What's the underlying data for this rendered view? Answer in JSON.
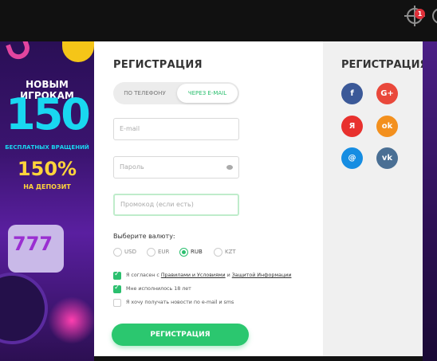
{
  "header": {
    "notification_count": "1"
  },
  "banner": {
    "line1": "НОВЫМ ИГРОКАМ",
    "line2": "150",
    "line3": "БЕСПЛАТНЫХ ВРАЩЕНИЙ",
    "line4": "150%",
    "line5": "НА ДЕПОЗИТ"
  },
  "form": {
    "title": "РЕГИСТРАЦИЯ",
    "tab_phone": "ПО ТЕЛЕФОНУ",
    "tab_email": "ЧЕРЕЗ E-MAIL",
    "email_placeholder": "E-mail",
    "password_placeholder": "Пароль",
    "promo_placeholder": "Промокод (если есть)",
    "currency_label": "Выберите валюту:",
    "currencies": [
      "USD",
      "EUR",
      "RUB",
      "KZT"
    ],
    "selected_currency": "RUB",
    "agree_prefix": "Я согласен с ",
    "agree_rules": "Правилами и Условиями",
    "agree_and": " и ",
    "agree_privacy": "Защитой Информации",
    "age_check": "Мне исполнилось 18 лет",
    "news_check": "Я хочу получать новости по e-mail и sms",
    "submit_label": "РЕГИСТРАЦИЯ"
  },
  "social": {
    "title": "РЕГИСТРАЦИЯ",
    "buttons": [
      {
        "glyph": "f",
        "color": "#3b5998"
      },
      {
        "glyph": "G+",
        "color": "#e9483b"
      },
      {
        "glyph": "Я",
        "color": "#e8312e"
      },
      {
        "glyph": "ok",
        "color": "#f3901e"
      },
      {
        "glyph": "@",
        "color": "#168de2"
      },
      {
        "glyph": "vk",
        "color": "#4a6f94"
      }
    ]
  },
  "colors": {
    "accent": "#2bc76f",
    "banner_cyan": "#19d7f0",
    "banner_yellow": "#ffd43b"
  }
}
